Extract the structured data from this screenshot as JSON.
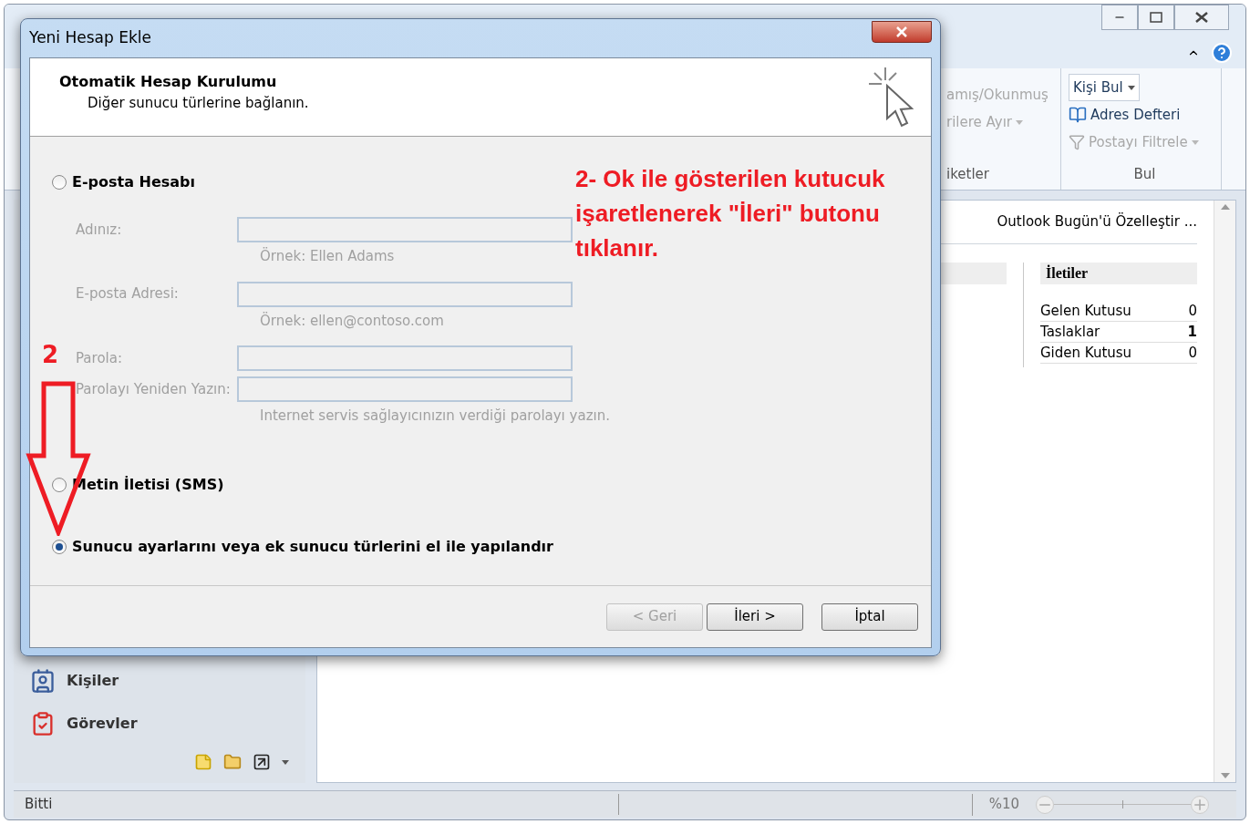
{
  "outlook": {
    "ribbon": {
      "groups": [
        {
          "label": "iketler",
          "items": [
            {
              "label": "amış/Okunmuş",
              "disabled": true,
              "has_menu": false
            },
            {
              "label": "rilere Ayır",
              "disabled": true,
              "has_menu": true
            }
          ]
        },
        {
          "label": "Bul",
          "search_box": {
            "value": "Kişi Bul"
          },
          "items": [
            {
              "label": "Adres Defteri",
              "disabled": false,
              "has_menu": false,
              "kind": "book"
            },
            {
              "label": "Postayı Filtrele",
              "disabled": true,
              "has_menu": true,
              "kind": "filter"
            }
          ]
        }
      ]
    },
    "navigation": {
      "items": [
        {
          "label": "Kişiler",
          "kind": "contacts"
        },
        {
          "label": "Görevler",
          "kind": "tasks"
        }
      ]
    },
    "today": {
      "customize_link": "Outlook Bugün'ü Özelleştir ...",
      "messages": {
        "title": "İletiler",
        "rows": [
          {
            "name": "Gelen Kutusu",
            "count": "0",
            "highlighted": false
          },
          {
            "name": "Taslaklar",
            "count": "1",
            "highlighted": true
          },
          {
            "name": "Giden Kutusu",
            "count": "0",
            "highlighted": false
          }
        ]
      }
    },
    "status_bar": {
      "text": "Bitti",
      "zoom": "%10"
    }
  },
  "dialog": {
    "title": "Yeni Hesap Ekle",
    "header": {
      "title": "Otomatik Hesap Kurulumu",
      "subtitle": "Diğer sunucu türlerine bağlanın."
    },
    "options": [
      {
        "label": "E-posta Hesabı",
        "selected": false,
        "fields": [
          {
            "label": "Adınız:",
            "hint": "Örnek: Ellen Adams",
            "disabled": true
          },
          {
            "label": "E-posta Adresi:",
            "hint": "Örnek: ellen@contoso.com",
            "disabled": true
          },
          {
            "label": "Parola:",
            "disabled": true
          },
          {
            "label": "Parolayı Yeniden Yazın:",
            "hint": "Internet servis sağlayıcınızın verdiği parolayı yazın.",
            "disabled": true
          }
        ]
      },
      {
        "label": "Metin İletisi (SMS)",
        "selected": false
      },
      {
        "label": "Sunucu ayarlarını veya ek sunucu türlerini el ile yapılandır",
        "selected": true
      }
    ],
    "buttons": [
      {
        "label": "< Geri",
        "disabled": true
      },
      {
        "label": "İleri >",
        "disabled": false
      },
      {
        "label": "İptal",
        "disabled": false
      }
    ]
  },
  "annotations": {
    "note": "2- Ok ile gösterilen kutucuk işaretlenerek \"İleri\" butonu tıklanır.",
    "step": "2"
  }
}
